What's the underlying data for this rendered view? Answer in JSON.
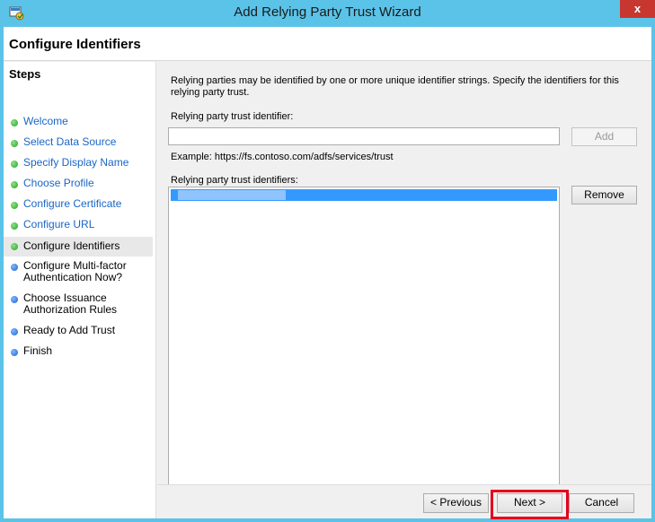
{
  "window": {
    "title": "Add Relying Party Trust Wizard",
    "close_glyph": "x"
  },
  "header": {
    "page_title": "Configure Identifiers"
  },
  "steps": {
    "heading": "Steps",
    "items": [
      {
        "label": "Welcome",
        "status": "done",
        "style": "link"
      },
      {
        "label": "Select Data Source",
        "status": "done",
        "style": "link"
      },
      {
        "label": "Specify Display Name",
        "status": "done",
        "style": "link"
      },
      {
        "label": "Choose Profile",
        "status": "done",
        "style": "link"
      },
      {
        "label": "Configure Certificate",
        "status": "done",
        "style": "link"
      },
      {
        "label": "Configure URL",
        "status": "done",
        "style": "link"
      },
      {
        "label": "Configure Identifiers",
        "status": "current",
        "style": "text"
      },
      {
        "label": "Configure Multi-factor Authentication Now?",
        "status": "pending",
        "style": "text"
      },
      {
        "label": "Choose Issuance Authorization Rules",
        "status": "pending",
        "style": "text"
      },
      {
        "label": "Ready to Add Trust",
        "status": "pending",
        "style": "text"
      },
      {
        "label": "Finish",
        "status": "pending",
        "style": "text"
      }
    ]
  },
  "main": {
    "description": "Relying parties may be identified by one or more unique identifier strings. Specify the identifiers for this relying party trust.",
    "identifier_label": "Relying party trust identifier:",
    "identifier_value": "",
    "add_label": "Add",
    "example": "Example: https://fs.contoso.com/adfs/services/trust",
    "identifiers_label": "Relying party trust identifiers:",
    "remove_label": "Remove"
  },
  "footer": {
    "previous_label": "< Previous",
    "next_label": "Next >",
    "cancel_label": "Cancel"
  },
  "colors": {
    "titlebar": "#5bc3e8",
    "link": "#1a66c6",
    "selection": "#3399ff",
    "highlight": "#e3001b",
    "done_dot": "#23a51b",
    "pending_dot": "#1a64d6"
  },
  "icons": {
    "app": "wizard-app-icon",
    "close": "close-icon"
  }
}
